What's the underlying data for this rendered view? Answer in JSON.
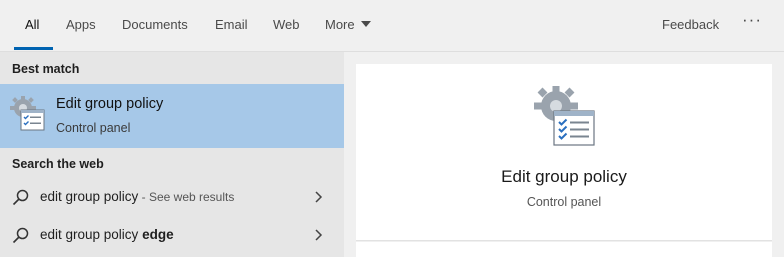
{
  "nav": {
    "tabs": [
      {
        "label": "All"
      },
      {
        "label": "Apps"
      },
      {
        "label": "Documents"
      },
      {
        "label": "Email"
      },
      {
        "label": "Web"
      },
      {
        "label": "More"
      }
    ],
    "active_tab": "All",
    "feedback_label": "Feedback",
    "overflow_label": "···"
  },
  "best_match": {
    "section_label": "Best match",
    "title": "Edit group policy",
    "subtitle": "Control panel",
    "icon": "group-policy-icon"
  },
  "web": {
    "section_label": "Search the web",
    "results": [
      {
        "query": "edit group policy",
        "hint": " - See web results"
      },
      {
        "query_prefix": "edit group policy ",
        "query_bold": "edge"
      }
    ]
  },
  "detail": {
    "title": "Edit group policy",
    "subtitle": "Control panel",
    "icon": "group-policy-icon"
  },
  "colors": {
    "accent": "#0063b1",
    "selection": "#a6c8e8"
  }
}
